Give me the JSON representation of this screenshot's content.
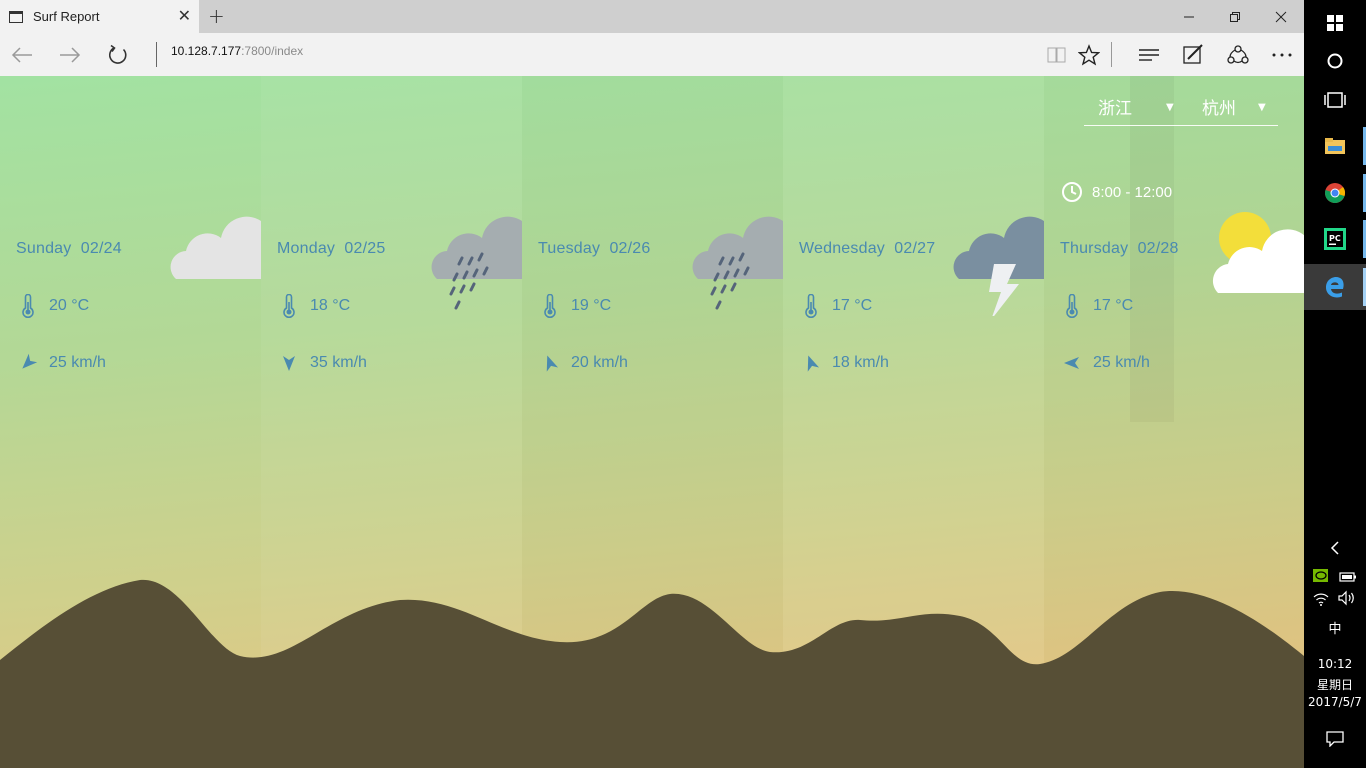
{
  "browser": {
    "tab_title": "Surf Report",
    "url_host": "10.128.7.177",
    "url_rest": ":7800/index"
  },
  "location": {
    "province": "浙江",
    "city": "杭州"
  },
  "time_range": "8:00 - 12:00",
  "chart_data": {
    "type": "table",
    "columns": [
      "day",
      "date",
      "weather",
      "temperature",
      "wind"
    ],
    "rows": [
      {
        "day": "Sunday",
        "date": "02/24",
        "weather": "cloudy",
        "temperature": "20 °C",
        "wind": "25 km/h",
        "wind_dir_deg": 225
      },
      {
        "day": "Monday",
        "date": "02/25",
        "weather": "rain",
        "temperature": "18 °C",
        "wind": "35 km/h",
        "wind_dir_deg": 180
      },
      {
        "day": "Tuesday",
        "date": "02/26",
        "weather": "rain",
        "temperature": "19 °C",
        "wind": "20 km/h",
        "wind_dir_deg": 340
      },
      {
        "day": "Wednesday",
        "date": "02/27",
        "weather": "thunderstorm",
        "temperature": "17 °C",
        "wind": "18 km/h",
        "wind_dir_deg": 340
      },
      {
        "day": "Thursday",
        "date": "02/28",
        "weather": "partly-cloudy",
        "temperature": "17 °C",
        "wind": "25 km/h",
        "wind_dir_deg": 270
      }
    ]
  },
  "taskbar": {
    "clock_time": "10:12",
    "clock_day": "星期日",
    "clock_date": "2017/5/7",
    "ime": "中"
  },
  "colors": {
    "text_blue": "#4a8ab0",
    "mountain": "#574f36"
  }
}
